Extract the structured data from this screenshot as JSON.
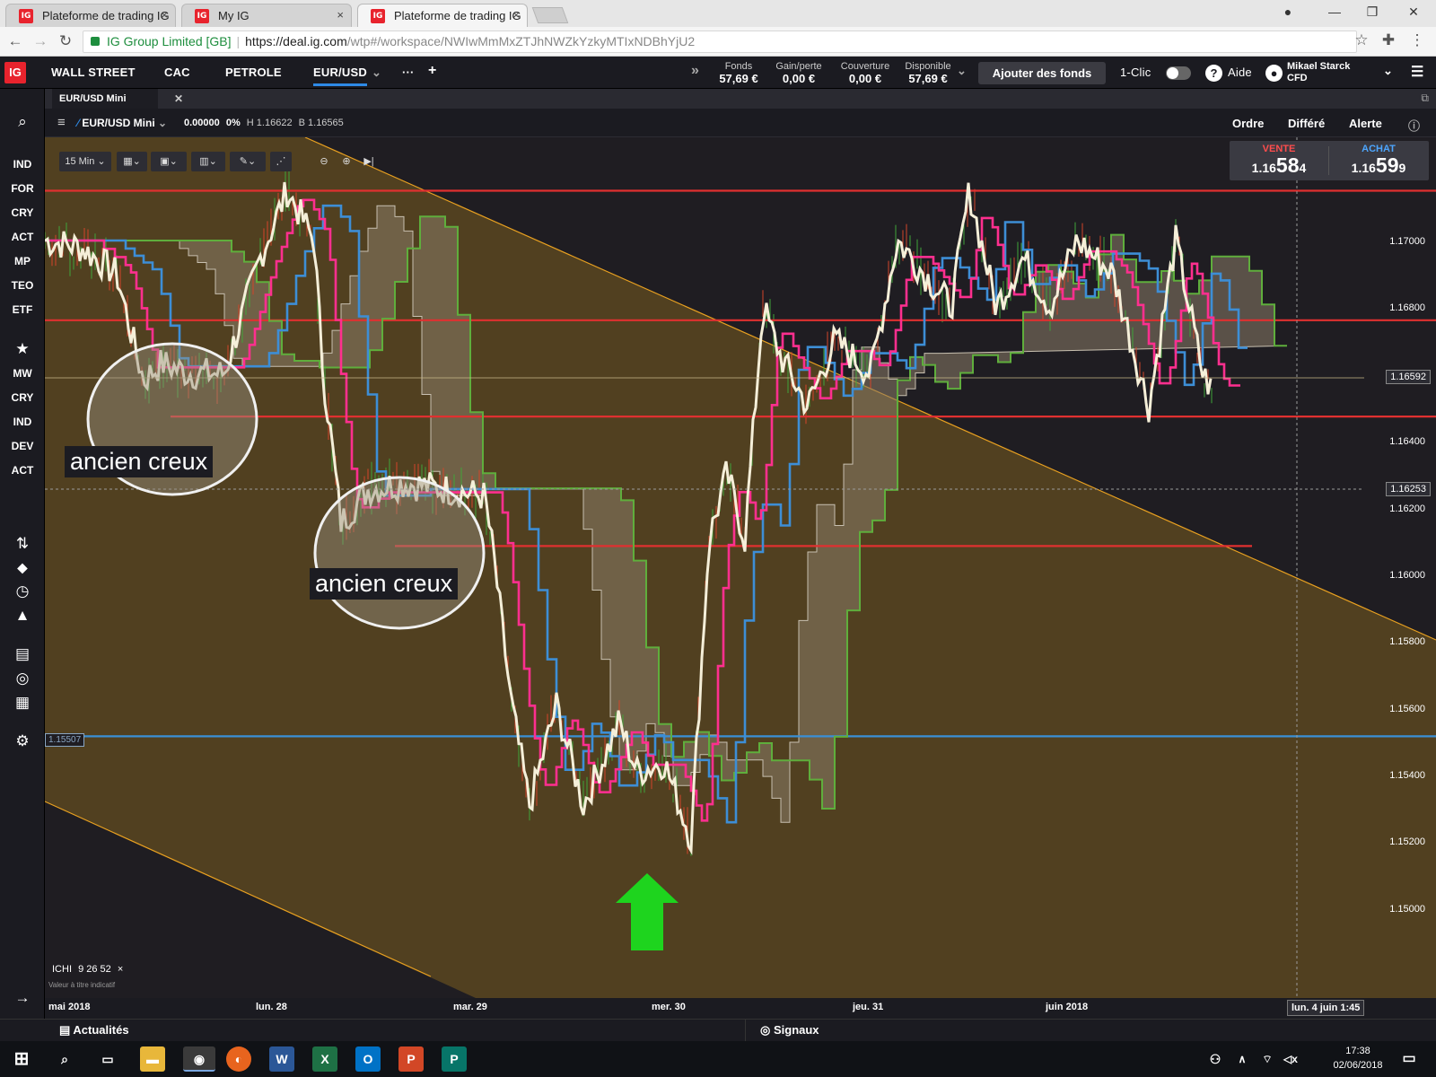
{
  "browser": {
    "tabs": [
      {
        "title": "Plateforme de trading IG",
        "icon": "IG"
      },
      {
        "title": "My IG",
        "icon": "IG"
      },
      {
        "title": "Plateforme de trading IG",
        "icon": "IG"
      }
    ],
    "close_glyph": "×",
    "secure_label": "IG Group Limited [GB]",
    "url_host": "https://deal.ig.com",
    "url_path": "/wtp#/workspace/NWIwMmMxZTJhNWZkYzkyMTIxNDBhYjU2"
  },
  "topnav": {
    "logo": "IG",
    "markets": [
      "WALL STREET",
      "CAC",
      "PETROLE",
      "EUR/USD"
    ],
    "more": "···",
    "add": "+",
    "expand": "»",
    "account": [
      {
        "label": "Fonds",
        "value": "57,69 €"
      },
      {
        "label": "Gain/perte",
        "value": "0,00 €"
      },
      {
        "label": "Couverture",
        "value": "0,00 €"
      },
      {
        "label": "Disponible",
        "value": "57,69 €"
      }
    ],
    "add_funds": "Ajouter des fonds",
    "one_click": "1-Clic",
    "help": "Aide",
    "user_name": "Mikael Starck",
    "user_type": "CFD"
  },
  "sidebar": {
    "items_top": [
      "IND",
      "FOR",
      "CRY",
      "ACT",
      "MP",
      "TEO",
      "ETF"
    ],
    "items_fav": [
      "MW",
      "CRY",
      "IND",
      "DEV",
      "ACT"
    ]
  },
  "workspace": {
    "tab": "EUR/USD Mini"
  },
  "chart_header": {
    "instrument": "EUR/USD Mini",
    "change": "0.00000",
    "change_pct": "0%",
    "high": "H 1.16622",
    "low": "B 1.16565",
    "actions": [
      "Ordre",
      "Différé",
      "Alerte"
    ]
  },
  "toolbar": {
    "timeframe": "15 Min"
  },
  "quote": {
    "sell_label": "VENTE",
    "sell_prefix": "1.16",
    "sell_big": "58",
    "sell_small": "4",
    "buy_label": "ACHAT",
    "buy_prefix": "1.16",
    "buy_big": "59",
    "buy_small": "9",
    "sell_color": "#ff4d4d",
    "buy_color": "#4da6ff"
  },
  "annotations": {
    "note1": "ancien creux",
    "note2": "ancien creux"
  },
  "indicator": {
    "name": "ICHI",
    "params": "9  26  52",
    "close": "×",
    "disclaimer": "Valeur à titre indicatif"
  },
  "chart_data": {
    "type": "line",
    "instrument": "EUR/USD Mini",
    "timeframe": "15 Min",
    "price_axis": [
      "1.17000",
      "1.16800",
      "1.16400",
      "1.16200",
      "1.16000",
      "1.15800",
      "1.15600",
      "1.15400",
      "1.15200",
      "1.15000"
    ],
    "price_markers": {
      "current": "1.16592",
      "crosshair": "1.16253",
      "hline": "1.15507"
    },
    "time_axis": [
      "mai 2018",
      "lun. 28",
      "mar. 29",
      "mer. 30",
      "jeu. 31",
      "juin 2018"
    ],
    "time_cursor": "lun. 4 juin 1:45",
    "ylim": [
      1.149,
      1.172
    ],
    "horizontal_lines": [
      {
        "price": 1.1715,
        "color": "#e03030"
      },
      {
        "price": 1.1676,
        "color": "#e03030"
      },
      {
        "price": 1.1647,
        "color": "#e03030"
      },
      {
        "price": 1.1608,
        "color": "#e03030"
      },
      {
        "price": 1.15507,
        "color": "#3a8fd6"
      }
    ],
    "colors": {
      "price_line": "#f5efd9",
      "tenkan": "#ff2f8f",
      "kijun": "#3d8ed6",
      "senkou_b": "#5fae3c",
      "cloud": "#6a5c4a",
      "channel": "#e8a020",
      "channel_fill": "#5a4720"
    }
  },
  "bottom_panels": {
    "news": "Actualités",
    "signals": "Signaux"
  },
  "taskbar": {
    "time": "17:38",
    "date": "02/06/2018"
  }
}
